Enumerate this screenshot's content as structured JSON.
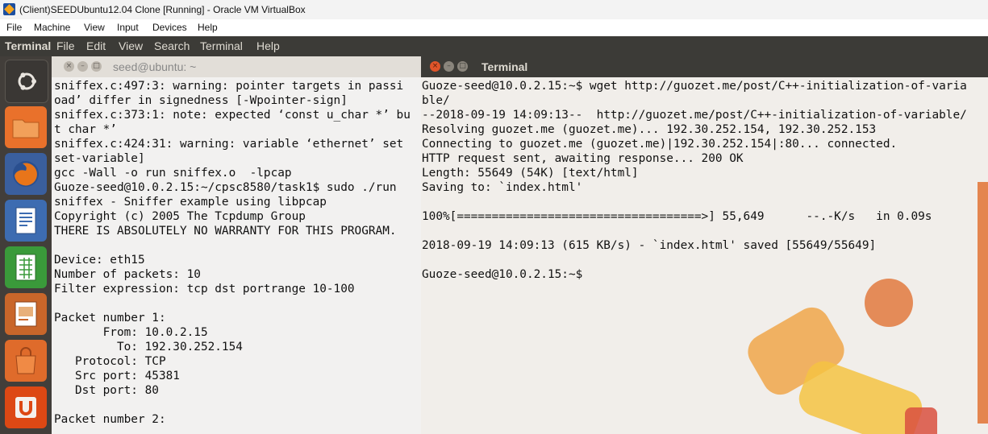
{
  "host_window": {
    "title": "(Client)SEEDUbuntu12.04 Clone [Running] - Oracle VM VirtualBox",
    "menu": [
      "File",
      "Machine",
      "View",
      "Input",
      "Devices",
      "Help"
    ]
  },
  "guest_panel": {
    "app_name": "Terminal",
    "menu": [
      "File",
      "Edit",
      "View",
      "Search",
      "Terminal",
      "Help"
    ]
  },
  "launcher": {
    "items": [
      {
        "name": "dash-home",
        "icon": "ubuntu-logo-icon",
        "color": "#3a3734"
      },
      {
        "name": "files",
        "icon": "folder-icon",
        "color": "#e9712b"
      },
      {
        "name": "firefox",
        "icon": "firefox-icon",
        "color": "#d86b1a"
      },
      {
        "name": "writer",
        "icon": "writer-document-icon",
        "color": "#3d6cb1"
      },
      {
        "name": "calc",
        "icon": "calc-spreadsheet-icon",
        "color": "#3a9a3a"
      },
      {
        "name": "impress",
        "icon": "impress-presentation-icon",
        "color": "#c9662a"
      },
      {
        "name": "software-center",
        "icon": "shopping-bag-icon",
        "color": "#df6b2b"
      },
      {
        "name": "ubuntu-one",
        "icon": "ubuntu-one-icon",
        "color": "#dd4814"
      }
    ]
  },
  "left_terminal": {
    "title": "seed@ubuntu: ~",
    "lines": [
      "sniffex.c:497:3: warning: pointer targets in passi",
      "oad’ differ in signedness [-Wpointer-sign]",
      "sniffex.c:373:1: note: expected ‘const u_char *’ bu",
      "t char *’",
      "sniffex.c:424:31: warning: variable ‘ethernet’ set",
      "set-variable]",
      "gcc -Wall -o run sniffex.o  -lpcap",
      "Guoze-seed@10.0.2.15:~/cpsc8580/task1$ sudo ./run",
      "sniffex - Sniffer example using libpcap",
      "Copyright (c) 2005 The Tcpdump Group",
      "THERE IS ABSOLUTELY NO WARRANTY FOR THIS PROGRAM.",
      "",
      "Device: eth15",
      "Number of packets: 10",
      "Filter expression: tcp dst portrange 10-100",
      "",
      "Packet number 1:",
      "       From: 10.0.2.15",
      "         To: 192.30.252.154",
      "   Protocol: TCP",
      "   Src port: 45381",
      "   Dst port: 80",
      "",
      "Packet number 2:"
    ]
  },
  "right_terminal": {
    "title": "Terminal",
    "lines": [
      "Guoze-seed@10.0.2.15:~$ wget http://guozet.me/post/C++-initialization-of-varia",
      "ble/",
      "--2018-09-19 14:09:13--  http://guozet.me/post/C++-initialization-of-variable/",
      "Resolving guozet.me (guozet.me)... 192.30.252.154, 192.30.252.153",
      "Connecting to guozet.me (guozet.me)|192.30.252.154|:80... connected.",
      "HTTP request sent, awaiting response... 200 OK",
      "Length: 55649 (54K) [text/html]",
      "Saving to: `index.html'",
      "",
      "100%[===================================>] 55,649      --.-K/s   in 0.09s",
      "",
      "2018-09-19 14:09:13 (615 KB/s) - `index.html' saved [55649/55649]",
      "",
      "Guoze-seed@10.0.2.15:~$"
    ]
  }
}
